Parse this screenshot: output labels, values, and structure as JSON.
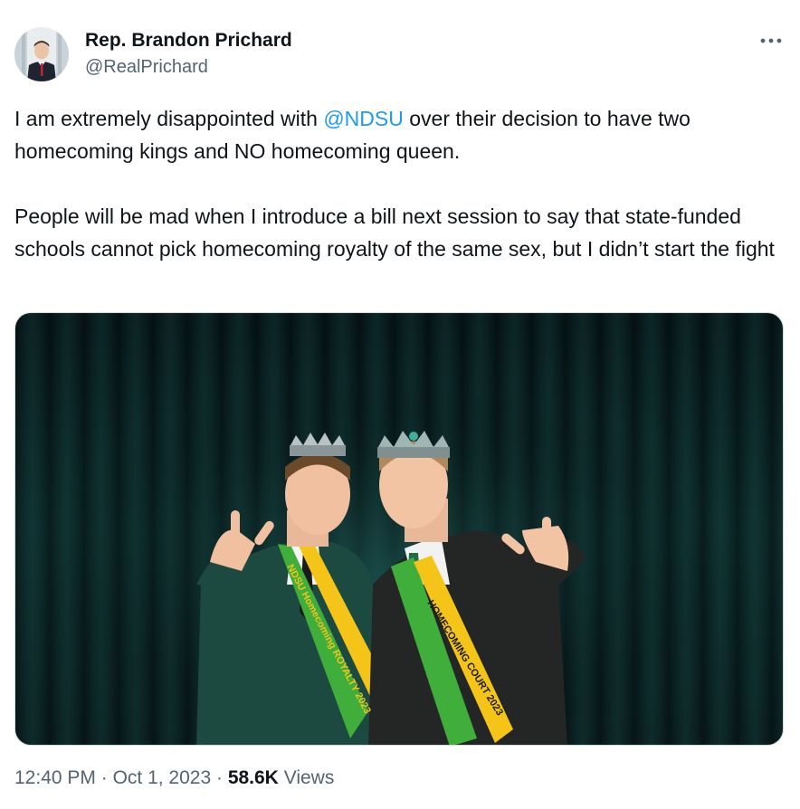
{
  "author": {
    "name": "Rep. Brandon Prichard",
    "handle": "@RealPrichard"
  },
  "tweet": {
    "text_before": "I am extremely disappointed with ",
    "mention": "@NDSU",
    "text_after": " over their decision to have two homecoming kings and NO homecoming queen.\n\nPeople will be mad when I introduce a bill next session to say that state-funded schools cannot pick homecoming royalty of the same sex, but I didn’t start the fight"
  },
  "media": {
    "sash_left_text": "NDSU Homecoming ROYALTY 2023",
    "sash_right_text": "HOMECOMING COURT 2023"
  },
  "meta": {
    "time": "12:40 PM",
    "sep1": " · ",
    "date": "Oct 1, 2023",
    "sep2": " · ",
    "views_count": "58.6K",
    "views_label": " Views"
  },
  "colors": {
    "link": "#1d9bf0",
    "secondary_text": "#536471",
    "primary_text": "#0f1419",
    "sash_green": "#3fae3a",
    "sash_yellow": "#f4c518",
    "curtain": "#0d2a2a"
  }
}
